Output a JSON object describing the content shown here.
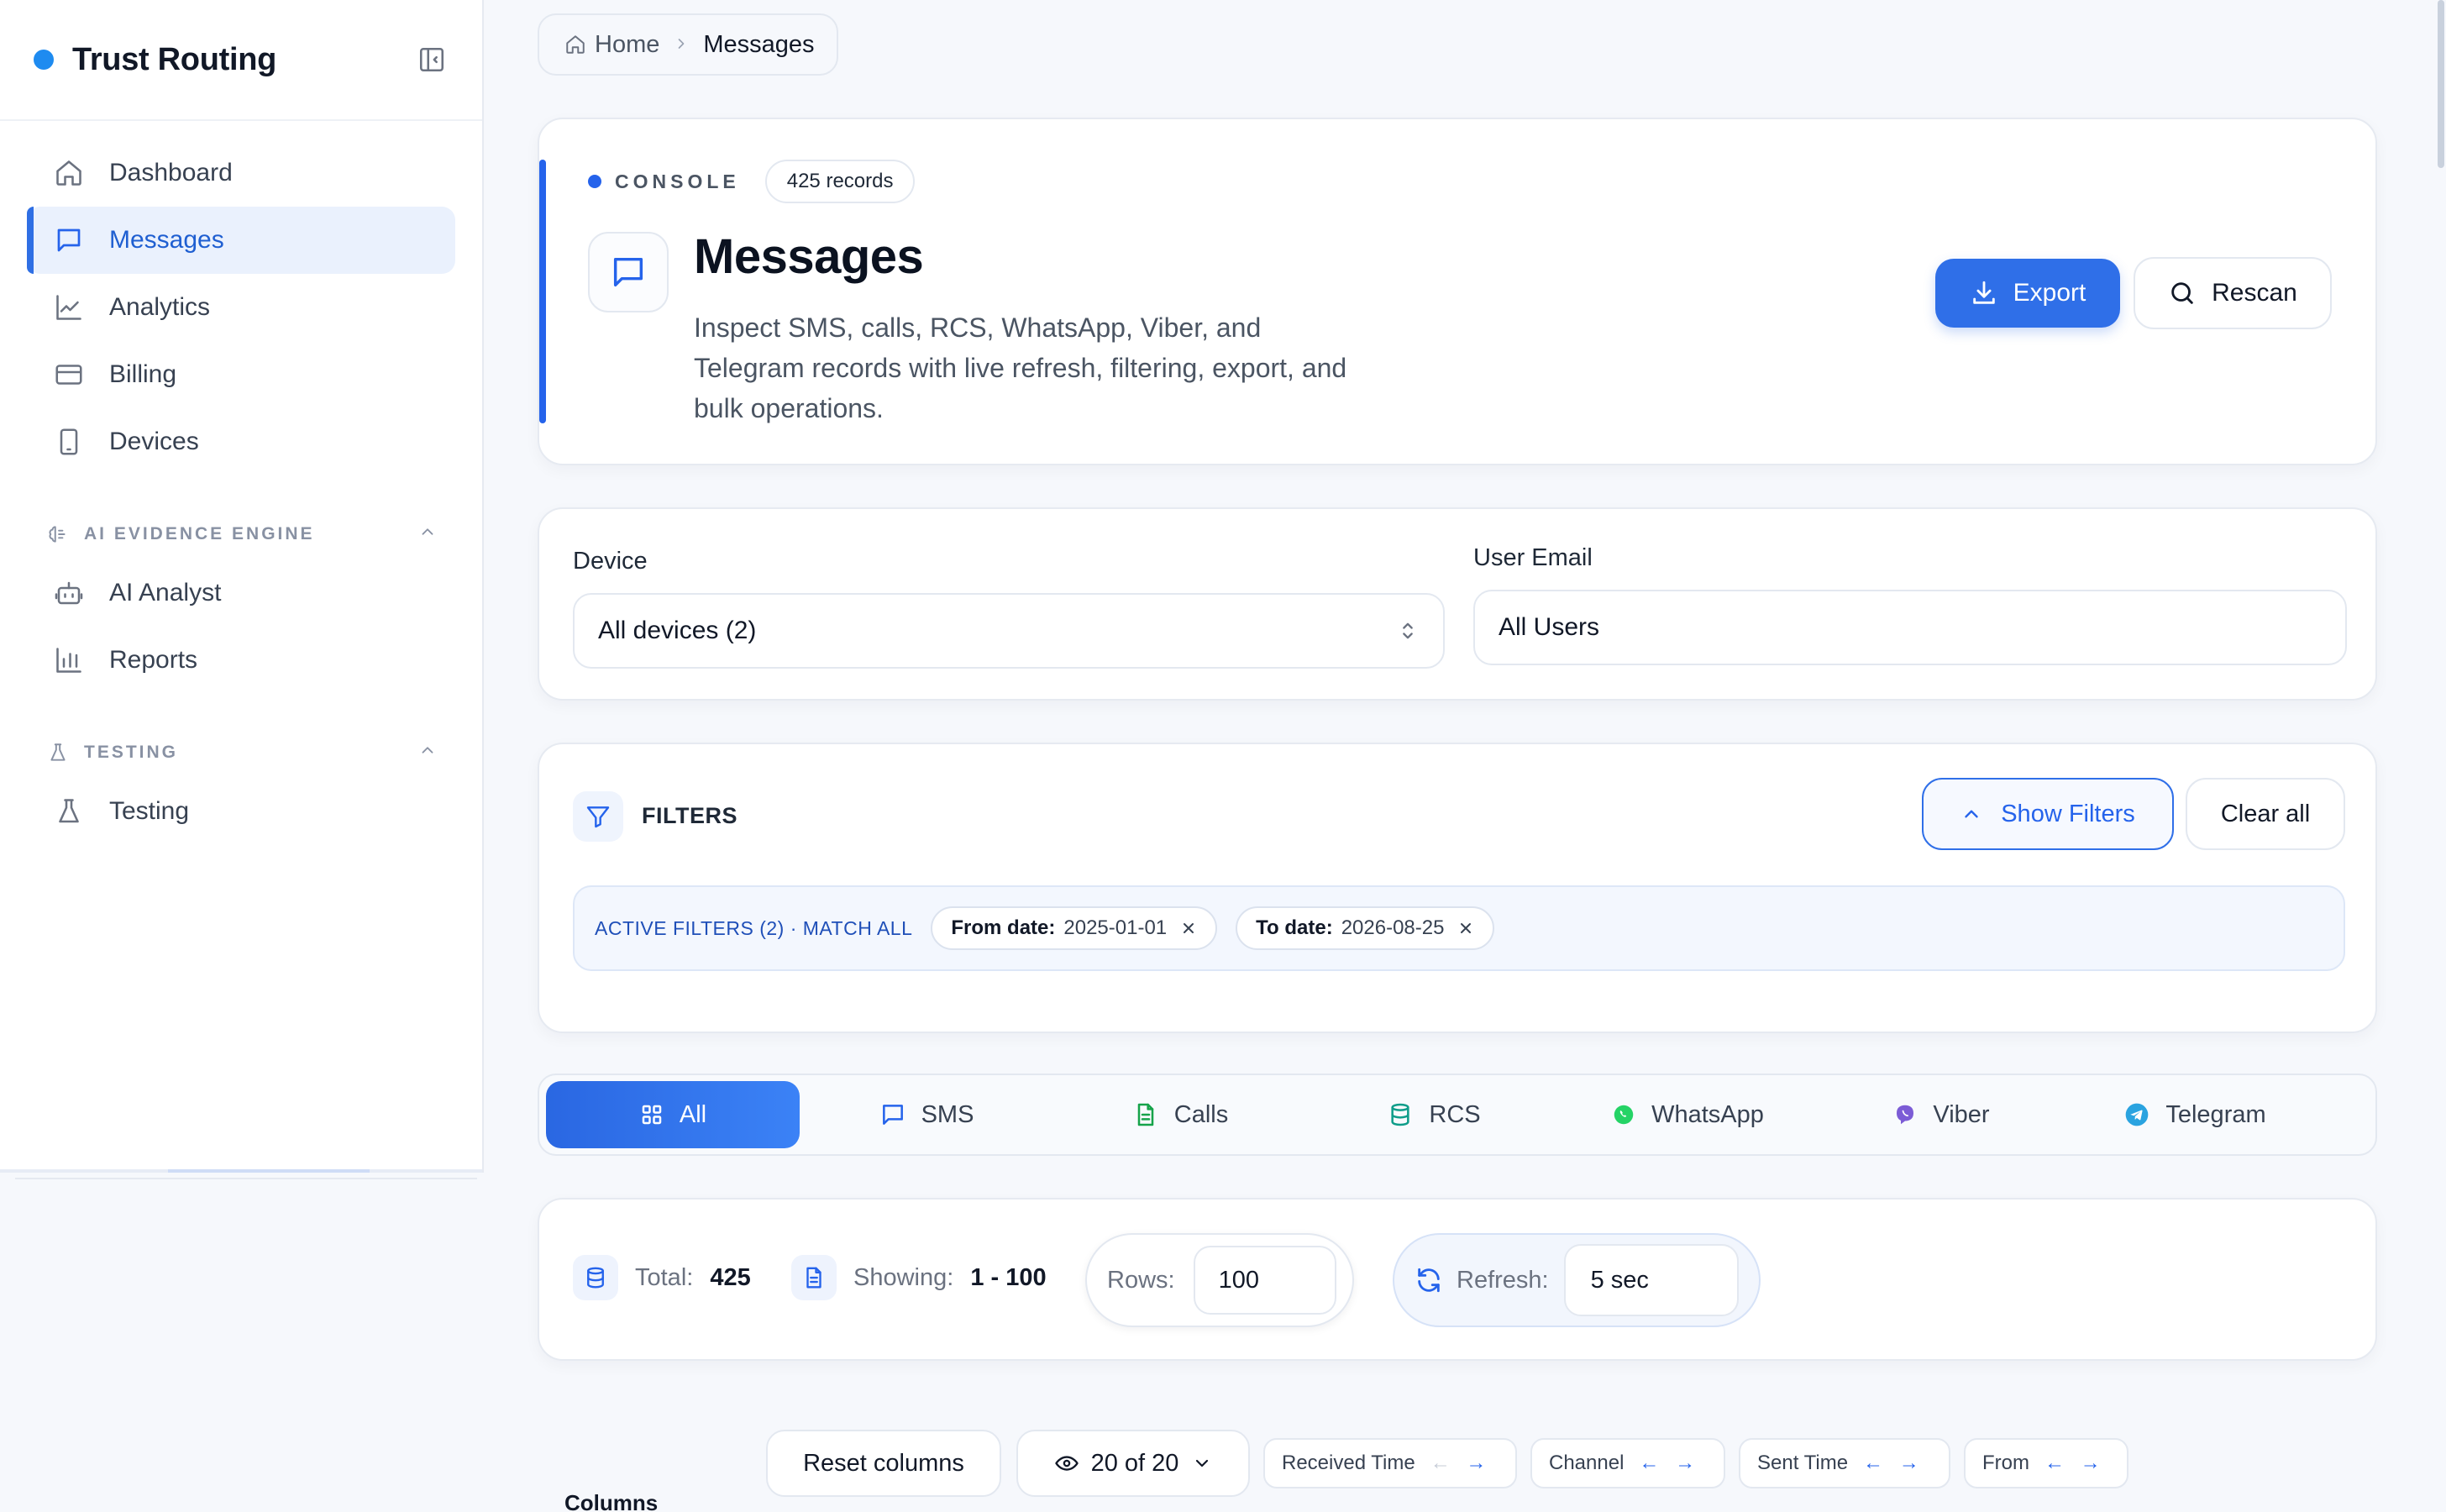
{
  "sidebar": {
    "brand": "Trust Routing",
    "items": [
      {
        "label": "Dashboard",
        "icon": "home-icon"
      },
      {
        "label": "Messages",
        "icon": "message-icon",
        "active": true
      },
      {
        "label": "Analytics",
        "icon": "line-chart-icon"
      },
      {
        "label": "Billing",
        "icon": "credit-card-icon"
      },
      {
        "label": "Devices",
        "icon": "smartphone-icon"
      }
    ],
    "sections": [
      {
        "title": "AI EVIDENCE ENGINE",
        "icon": "brain-icon",
        "items": [
          {
            "label": "AI Analyst",
            "icon": "bot-icon"
          },
          {
            "label": "Reports",
            "icon": "bar-chart-icon"
          }
        ]
      },
      {
        "title": "TESTING",
        "icon": "flask-icon",
        "items": [
          {
            "label": "Testing",
            "icon": "flask-icon"
          }
        ]
      }
    ]
  },
  "breadcrumb": {
    "home": "Home",
    "current": "Messages"
  },
  "hero": {
    "eyebrow": "CONSOLE",
    "records": "425 records",
    "title": "Messages",
    "description": "Inspect SMS, calls, RCS, WhatsApp, Viber, and Telegram records with live refresh, filtering, export, and bulk operations.",
    "export_label": "Export",
    "rescan_label": "Rescan"
  },
  "selectors": {
    "device_label": "Device",
    "device_value": "All devices (2)",
    "email_label": "User Email",
    "email_value": "All Users"
  },
  "filters": {
    "title": "FILTERS",
    "show_label": "Show Filters",
    "clear_label": "Clear all",
    "active_label": "ACTIVE FILTERS (2) · MATCH ALL",
    "chips": [
      {
        "key": "From date:",
        "value": "2025-01-01"
      },
      {
        "key": "To date:",
        "value": "2026-08-25"
      }
    ]
  },
  "tabs": [
    {
      "label": "All",
      "active": true
    },
    {
      "label": "SMS"
    },
    {
      "label": "Calls"
    },
    {
      "label": "RCS"
    },
    {
      "label": "WhatsApp"
    },
    {
      "label": "Viber"
    },
    {
      "label": "Telegram"
    }
  ],
  "stats": {
    "total_label": "Total:",
    "total_value": "425",
    "showing_label": "Showing:",
    "showing_value": "1 - 100",
    "rows_label": "Rows:",
    "rows_value": "100",
    "refresh_label": "Refresh:",
    "refresh_value": "5 sec"
  },
  "columns": {
    "label": "Columns",
    "reset_label": "Reset columns",
    "visible_label": "20 of 20",
    "chips": [
      "Received Time",
      "Channel",
      "Sent Time",
      "From"
    ]
  },
  "colors": {
    "accent": "#2f6fe8",
    "brand_dot": "#1e8bf0",
    "whatsapp": "#25d366",
    "viber": "#7c5cd6",
    "telegram": "#2aa3e0",
    "calls": "#16a34a",
    "rcs": "#0f9d8a"
  }
}
